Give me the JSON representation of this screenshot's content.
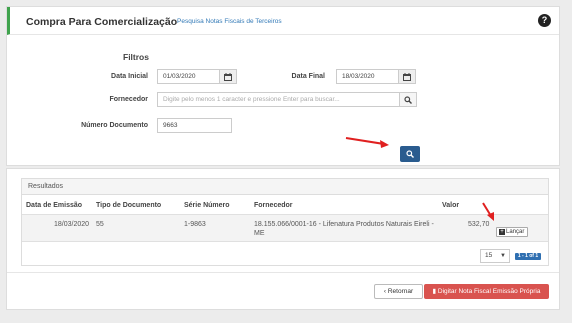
{
  "header": {
    "title": "Compra Para Comercialização",
    "sub_link": "Pesquisa Notas Fiscais de Terceiros",
    "help": "?"
  },
  "filters": {
    "heading": "Filtros",
    "data_inicial_label": "Data Inicial",
    "data_inicial_value": "01/03/2020",
    "data_final_label": "Data Final",
    "data_final_value": "18/03/2020",
    "fornecedor_label": "Fornecedor",
    "fornecedor_placeholder": "Digite pelo menos 1 caracter e pressione Enter para buscar...",
    "numero_label": "Número Documento",
    "numero_value": "9663"
  },
  "results": {
    "title": "Resultados",
    "columns": [
      "Data de Emissão",
      "Tipo de Documento",
      "Série Número",
      "Fornecedor",
      "Valor"
    ],
    "rows": [
      {
        "data": "18/03/2020",
        "tipo": "55",
        "serie": "1-9863",
        "fornecedor_line1": "18.155.066/0001-16 - Lifenatura Produtos Naturais Eireli -",
        "fornecedor_line2": "ME",
        "valor": "532,70",
        "action": "Lançar"
      }
    ],
    "page_size": "15",
    "pagination": "1 - 1 of 1"
  },
  "footer": {
    "retornar": "Retornar",
    "digitar": "Digitar Nota Fiscal Emissão Própria"
  },
  "colors": {
    "accent_green": "#3fa34d",
    "primary_blue": "#2a5c8f",
    "danger_red": "#d9534f",
    "annotation_red": "#e02020"
  }
}
